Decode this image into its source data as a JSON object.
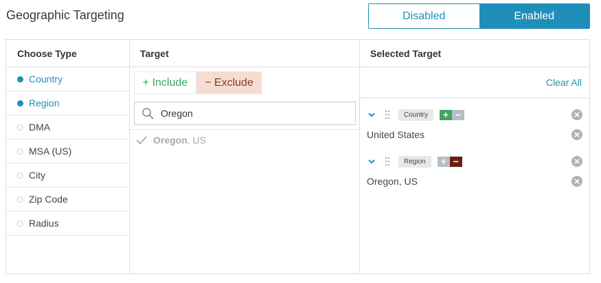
{
  "header": {
    "title": "Geographic Targeting",
    "toggle": {
      "disabled_label": "Disabled",
      "enabled_label": "Enabled",
      "selected": "Enabled"
    }
  },
  "columns": {
    "choose_type": "Choose Type",
    "target": "Target",
    "selected_target": "Selected Target"
  },
  "types": [
    {
      "label": "Country",
      "active": true
    },
    {
      "label": "Region",
      "active": true
    },
    {
      "label": "DMA",
      "active": false
    },
    {
      "label": "MSA (US)",
      "active": false
    },
    {
      "label": "City",
      "active": false
    },
    {
      "label": "Zip Code",
      "active": false
    },
    {
      "label": "Radius",
      "active": false
    }
  ],
  "target": {
    "include_label": "+ Include",
    "exclude_label": "− Exclude",
    "search_value": "Oregon",
    "result": {
      "match": "Oregon",
      "suffix": ", US",
      "icon": "check-icon"
    }
  },
  "selected": {
    "clear_all": "Clear All",
    "groups": [
      {
        "tag": "Country",
        "mode": "include",
        "value": "United States"
      },
      {
        "tag": "Region",
        "mode": "exclude",
        "value": "Oregon, US"
      }
    ]
  },
  "colors": {
    "accent": "#1f8fba",
    "include_green": "#3aa65a",
    "exclude_dark": "#6b1e10",
    "exclude_bg": "#f6ddd2"
  }
}
